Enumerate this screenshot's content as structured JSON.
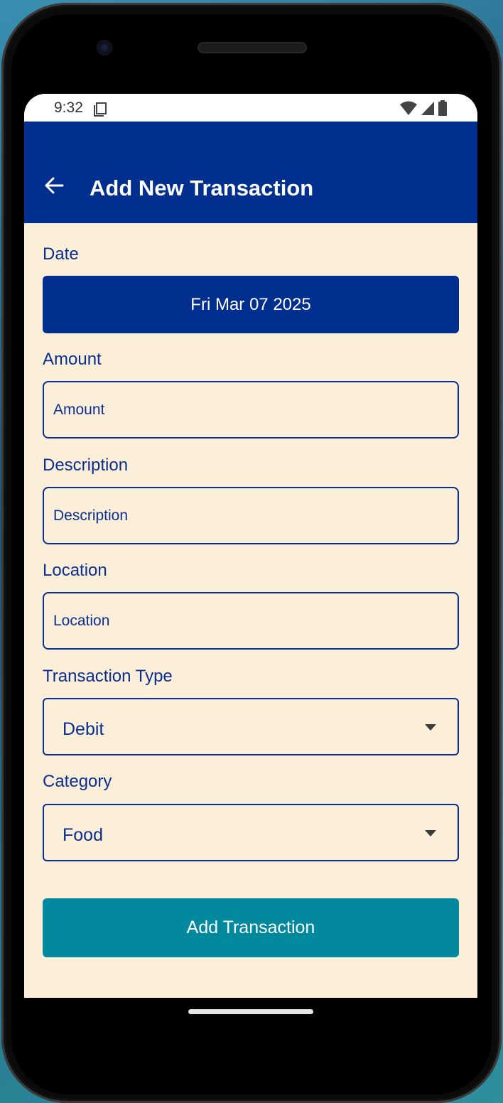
{
  "status_bar": {
    "time": "9:32",
    "icons": [
      "sim-card-icon",
      "wifi-icon",
      "signal-icon",
      "battery-icon"
    ]
  },
  "app_bar": {
    "back_icon": "arrow-left-icon",
    "title": "Add New Transaction"
  },
  "form": {
    "date": {
      "label": "Date",
      "value": "Fri Mar 07 2025"
    },
    "amount": {
      "label": "Amount",
      "placeholder": "Amount",
      "value": ""
    },
    "description": {
      "label": "Description",
      "placeholder": "Description",
      "value": ""
    },
    "location": {
      "label": "Location",
      "placeholder": "Location",
      "value": ""
    },
    "transaction_type": {
      "label": "Transaction Type",
      "selected": "Debit"
    },
    "category": {
      "label": "Category",
      "selected": "Food"
    },
    "submit_label": "Add Transaction"
  },
  "colors": {
    "app_bar": "#012f8f",
    "background": "#fcefd9",
    "primary_text": "#0a2f8f",
    "submit_button": "#02899e"
  }
}
